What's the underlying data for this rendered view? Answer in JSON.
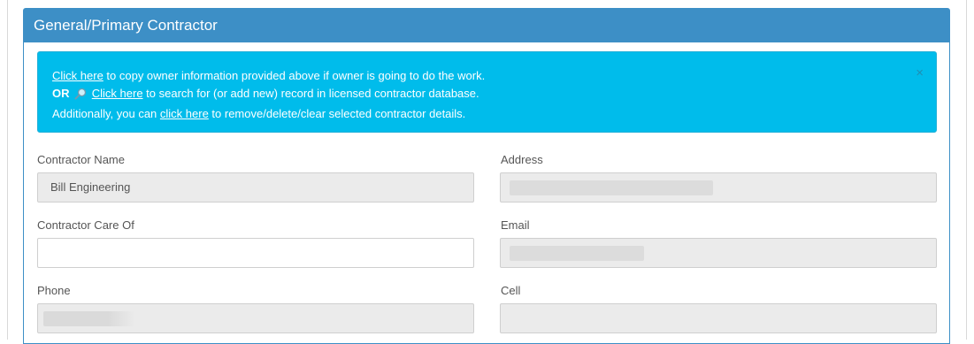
{
  "panel": {
    "title": "General/Primary Contractor"
  },
  "alert": {
    "line1_link": "Click here",
    "line1_text": " to copy owner information provided above if owner is going to do the work.",
    "line2_or": "OR",
    "line2_link": "Click here",
    "line2_text": " to search for (or add new) record in licensed contractor database.",
    "line3_prefix": "Additionally, you can ",
    "line3_link": "click here",
    "line3_text": " to remove/delete/clear selected contractor details.",
    "close": "×"
  },
  "fields": {
    "contractor_name": {
      "label": "Contractor Name",
      "value": "Bill Engineering"
    },
    "address": {
      "label": "Address",
      "value": ""
    },
    "contractor_care_of": {
      "label": "Contractor Care Of",
      "value": ""
    },
    "email": {
      "label": "Email",
      "value": ""
    },
    "phone": {
      "label": "Phone",
      "value": ""
    },
    "cell": {
      "label": "Cell",
      "value": ""
    }
  },
  "colors": {
    "header": "#3d8fc6",
    "alert": "#00bceb",
    "readonly_input": "#ebebeb"
  }
}
